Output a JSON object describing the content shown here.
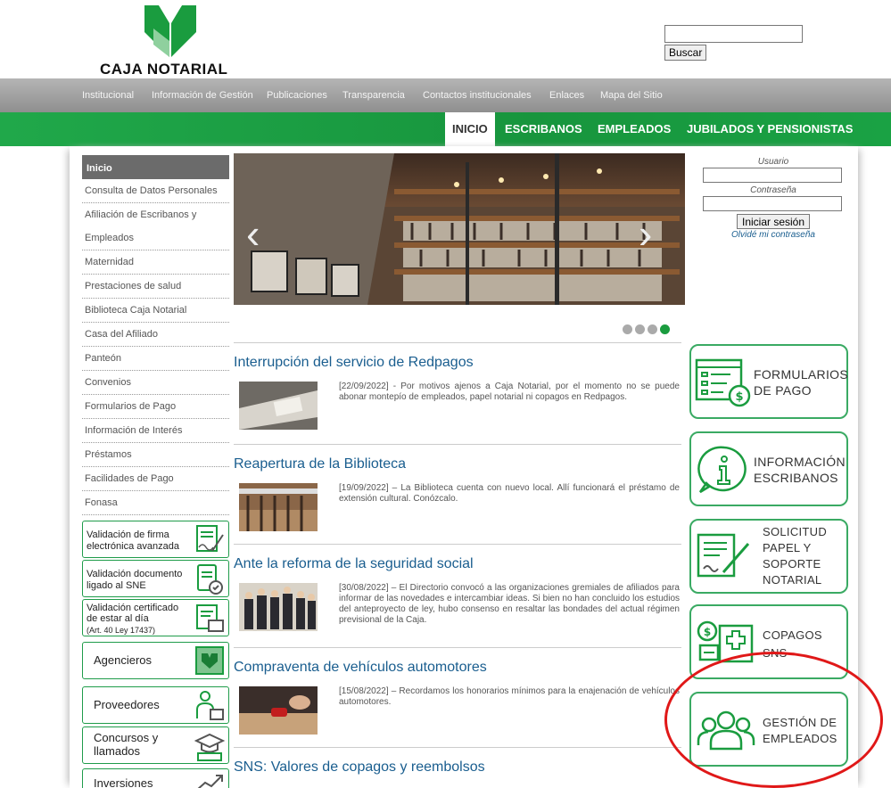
{
  "header": {
    "logo_text": "CAJA NOTARIAL",
    "search_button": "Buscar",
    "search_value": ""
  },
  "topnav": [
    "Institucional",
    "Información de Gestión",
    "Publicaciones",
    "Transparencia",
    "Contactos institucionales",
    "Enlaces",
    "Mapa del Sitio"
  ],
  "mainnav": [
    "INICIO",
    "ESCRIBANOS",
    "EMPLEADOS",
    "JUBILADOS Y PENSIONISTAS"
  ],
  "sidebar": {
    "head": "Inicio",
    "items": [
      "Consulta de Datos Personales",
      "Afiliación de Escribanos y",
      "Empleados",
      "Maternidad",
      "Prestaciones de salud",
      "Biblioteca Caja Notarial",
      "Casa del Afiliado",
      "Panteón",
      "Convenios",
      "Formularios de Pago",
      "Información de Interés",
      "Préstamos",
      "Facilidades de Pago",
      "Fonasa"
    ],
    "boxes": [
      {
        "lines": [
          "Validación de firma",
          "electrónica avanzada"
        ],
        "icon": "signature-document-icon"
      },
      {
        "lines": [
          "Validación documento",
          "ligado al SNE"
        ],
        "icon": "document-check-icon"
      },
      {
        "lines": [
          "Validación certificado",
          "de estar al día",
          "(Art. 40 Ley 17437)"
        ],
        "icon": "certificate-icon"
      },
      {
        "lines": [
          "Agencieros"
        ],
        "icon": "green-square-icon"
      },
      {
        "lines": [
          "Proveedores"
        ],
        "icon": "supplier-icon"
      },
      {
        "lines": [
          "Concursos y",
          "llamados"
        ],
        "icon": "graduation-icon"
      },
      {
        "lines": [
          "Inversiones"
        ],
        "icon": "chart-icon"
      }
    ]
  },
  "slider": {
    "dots": 4,
    "active": 3,
    "prev": "‹",
    "next": "›"
  },
  "news": [
    {
      "title": "Interrupción del servicio de Redpagos",
      "text": "[22/09/2022] - Por motivos ajenos a Caja Notarial, por el momento no se puede abonar montepío de empleados, papel notarial ni copagos en Redpagos."
    },
    {
      "title": "Reapertura de la Biblioteca",
      "text": "[19/09/2022] – La Biblioteca cuenta con nuevo local. Allí funcionará el préstamo de extensión cultural. Conózcalo."
    },
    {
      "title": "Ante la reforma de la seguridad social",
      "text": "[30/08/2022] – El Directorio convocó a las organizaciones gremiales de afiliados para informar de las novedades e intercambiar ideas. Si bien no han concluido los estudios del anteproyecto de ley, hubo consenso en resaltar las bondades del actual régimen previsional de la Caja."
    },
    {
      "title": "Compraventa de vehículos automotores",
      "text": "[15/08/2022] – Recordamos los honorarios mínimos para la enajenación de vehículos automotores."
    },
    {
      "title": "SNS: Valores de copagos y reembolsos",
      "text": ""
    }
  ],
  "login": {
    "user_label": "Usuario",
    "pass_label": "Contraseña",
    "button": "Iniciar sesión",
    "forgot": "Olvidé mi contraseña"
  },
  "right_boxes": [
    {
      "lines": [
        "FORMULARIOS",
        "DE PAGO"
      ],
      "icon": "payment-form-icon"
    },
    {
      "lines": [
        "INFORMACIÓN",
        "ESCRIBANOS"
      ],
      "icon": "info-icon"
    },
    {
      "lines": [
        "SOLICITUD",
        "PAPEL Y",
        "SOPORTE",
        "NOTARIAL"
      ],
      "icon": "paper-request-icon"
    },
    {
      "lines": [
        "COPAGOS",
        "SNS"
      ],
      "icon": "copay-icon"
    },
    {
      "lines": [
        "GESTIÓN DE",
        "EMPLEADOS"
      ],
      "icon": "people-icon"
    }
  ],
  "colors": {
    "brand_green": "#1a9c3f",
    "link_blue": "#1a5e8f",
    "highlight_red": "#e01818"
  }
}
